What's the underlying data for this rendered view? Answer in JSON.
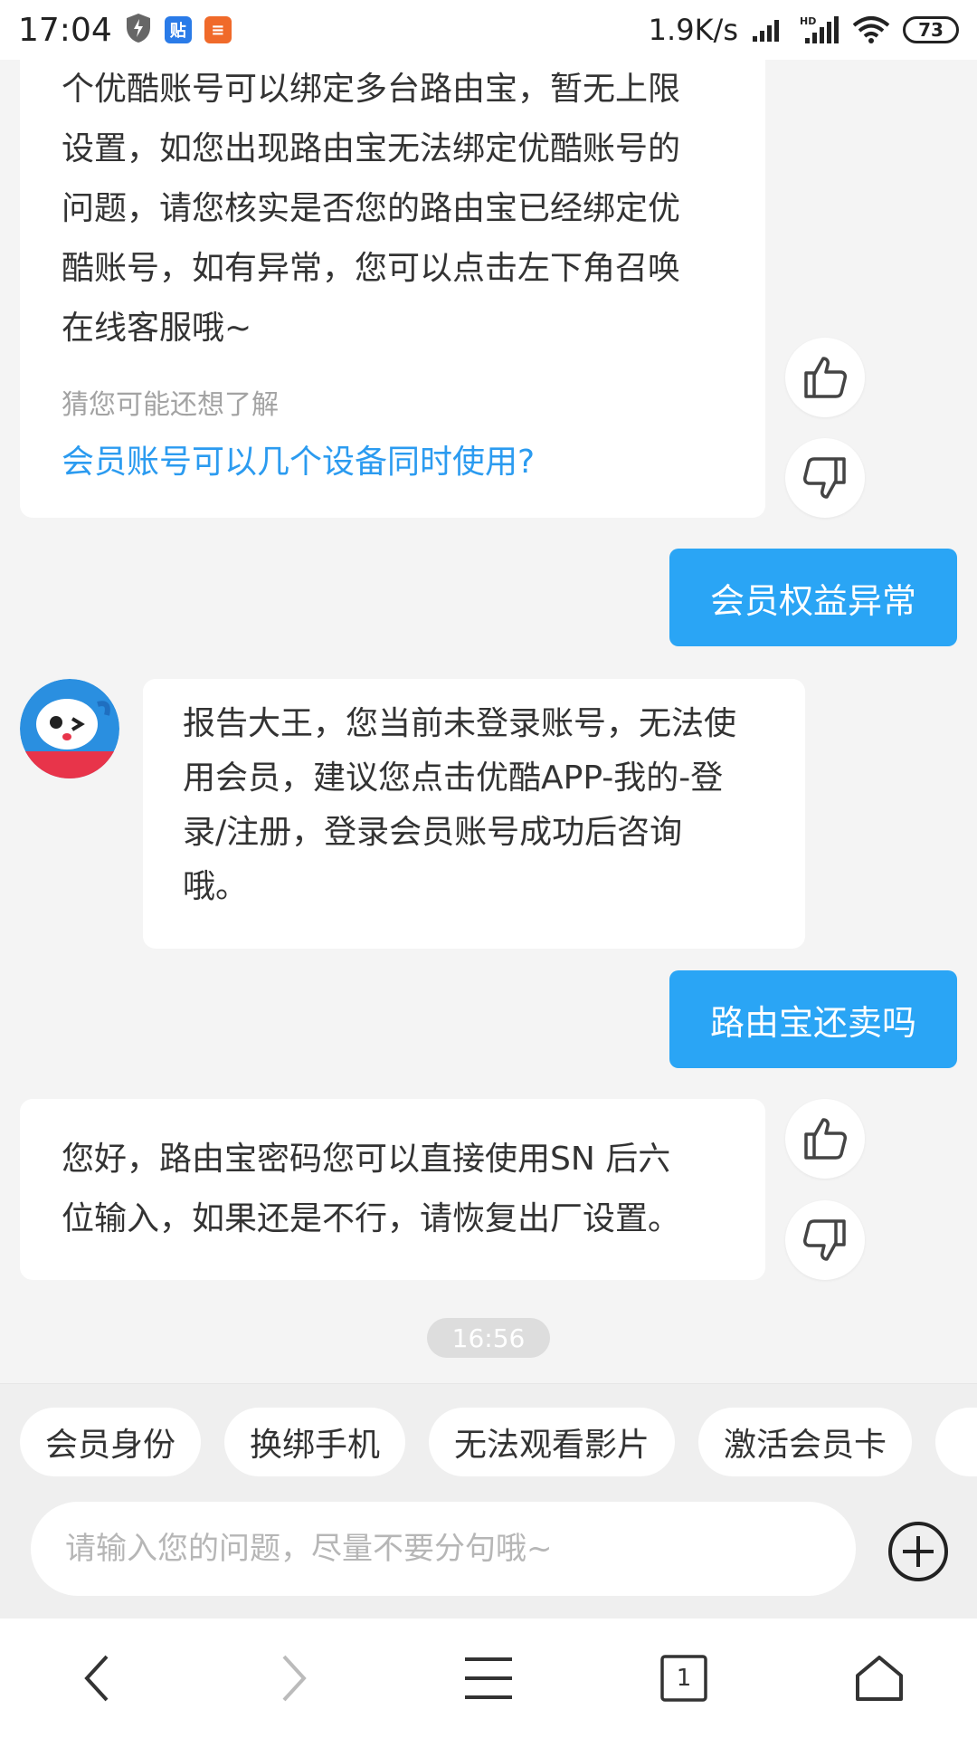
{
  "status_bar": {
    "time": "17:04",
    "speed": "1.9K/s",
    "battery": "73",
    "app_icons": [
      {
        "icon": "shield-icon",
        "label": ""
      },
      {
        "icon": "tieba-icon",
        "label": "贴"
      },
      {
        "icon": "app-icon",
        "label": "≡"
      }
    ]
  },
  "chat": {
    "bot_answer_1": {
      "lines": [
        "个优酷账号可以绑定多台路由宝，暂无上限",
        "设置，如您出现路由宝无法绑定优酷账号的",
        "问题，请您核实是否您的路由宝已经绑定优",
        "酷账号，如有异常，您可以点击左下角召唤",
        "在线客服哦~"
      ],
      "suggest_title": "猜您可能还想了解",
      "suggest_link": "会员账号可以几个设备同时使用?"
    },
    "user_msg_1": "会员权益异常",
    "bot_answer_2": {
      "lines": [
        "报告大王，您当前未登录账号，无法使",
        "用会员，建议您点击优酷APP-我的-登",
        "录/注册，登录会员账号成功后咨询",
        "哦。"
      ]
    },
    "user_msg_2": "路由宝还卖吗",
    "bot_answer_3": {
      "lines": [
        "您好，路由宝密码您可以直接使用SN 后六",
        "位输入，如果还是不行，请恢复出厂设置。"
      ]
    },
    "timestamp": "16:56"
  },
  "quick_replies": [
    "会员身份",
    "换绑手机",
    "无法观看影片",
    "激活会员卡"
  ],
  "input": {
    "placeholder": "请输入您的问题，尽量不要分句哦~",
    "value": ""
  },
  "navbar": {
    "tab_count": "1"
  },
  "colors": {
    "accent": "#2aa5f5",
    "link": "#2b9bf0",
    "background": "#f4f4f4"
  }
}
